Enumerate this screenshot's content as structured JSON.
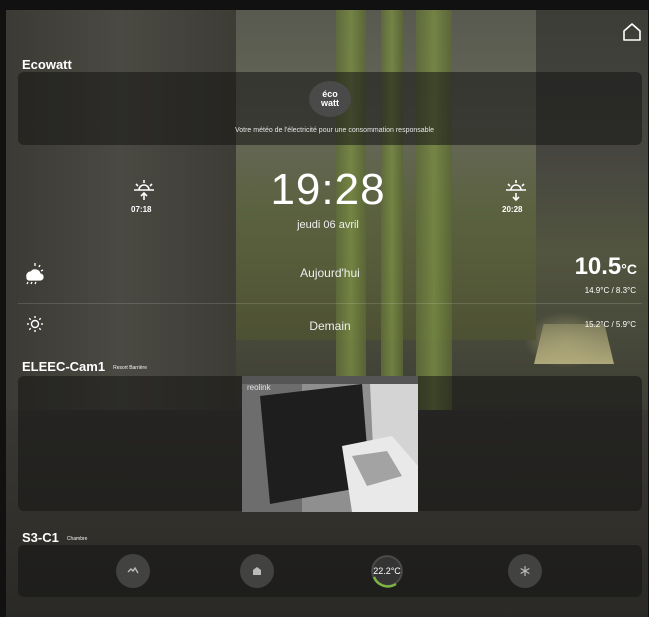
{
  "ecowatt": {
    "title": "Ecowatt",
    "logo_line1": "éco",
    "logo_line2": "watt",
    "tagline": "Votre météo de l'électricité pour une consommation responsable"
  },
  "clock": {
    "time": "19:28",
    "date": "jeudi 06 avril",
    "sunrise": "07:18",
    "sunset": "20:28"
  },
  "weather": {
    "today_label": "Aujourd'hui",
    "today_temp": "10.5",
    "today_unit": "°C",
    "today_range": "14.9°C / 8.3°C",
    "tomorrow_label": "Demain",
    "tomorrow_range": "15.2°C / 5.9°C",
    "today_icon": "cloudy-rain-icon",
    "tomorrow_icon": "sun-icon"
  },
  "camera": {
    "title": "ELEEC-Cam1",
    "subtitle": "Resort Barrière",
    "brand": "reolink"
  },
  "climate": {
    "title": "S3-C1",
    "subtitle": "Chambre",
    "temperature": "22.2°C",
    "accent": "#7cb342"
  }
}
